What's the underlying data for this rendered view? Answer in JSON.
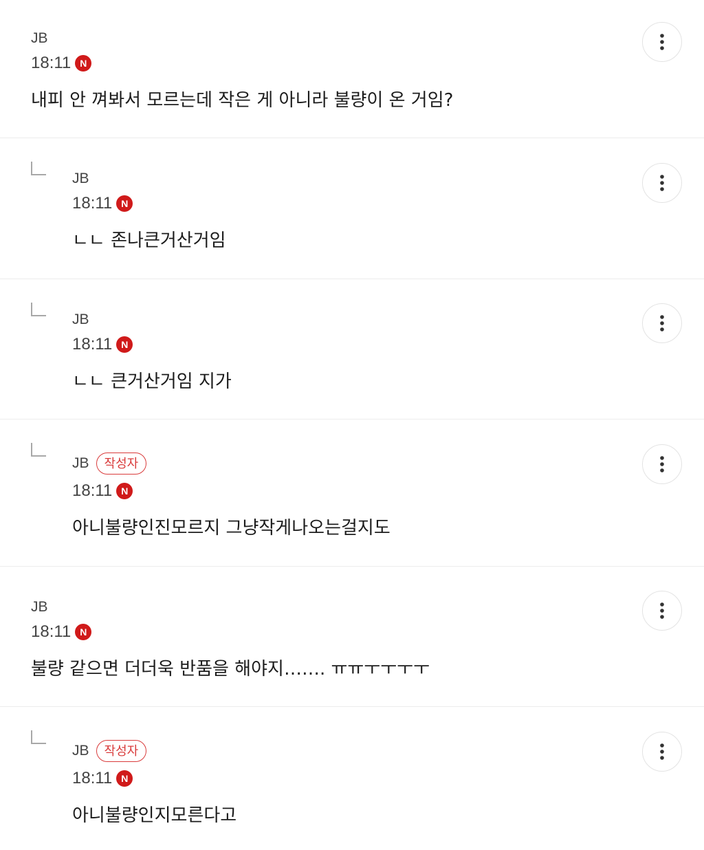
{
  "comments": [
    {
      "author": "JB",
      "time": "18:11",
      "badge_letter": "N",
      "text": "내피 안 껴봐서 모르는데 작은 게 아니라 불량이 온 거임?"
    },
    {
      "author": "JB",
      "time": "18:11",
      "badge_letter": "N",
      "text": "ㄴㄴ 존나큰거산거임"
    },
    {
      "author": "JB",
      "time": "18:11",
      "badge_letter": "N",
      "text": "ㄴㄴ 큰거산거임 지가"
    },
    {
      "author": "JB",
      "writer_label": "작성자",
      "time": "18:11",
      "badge_letter": "N",
      "text": "아니불량인진모르지 그냥작게나오는걸지도"
    },
    {
      "author": "JB",
      "time": "18:11",
      "badge_letter": "N",
      "text": "불량 같으면 더더욱 반품을 해야지……. ㅠㅠㅜㅜㅜㅜ"
    },
    {
      "author": "JB",
      "writer_label": "작성자",
      "time": "18:11",
      "badge_letter": "N",
      "text": "아니불량인지모른다고"
    }
  ],
  "icons": {
    "more": "vertical-ellipsis-icon",
    "new": "new-badge-icon",
    "reply": "reply-arrow-icon"
  },
  "colors": {
    "badge_red": "#d01a1a",
    "writer_badge": "#d93b3b",
    "divider": "#ececec"
  }
}
